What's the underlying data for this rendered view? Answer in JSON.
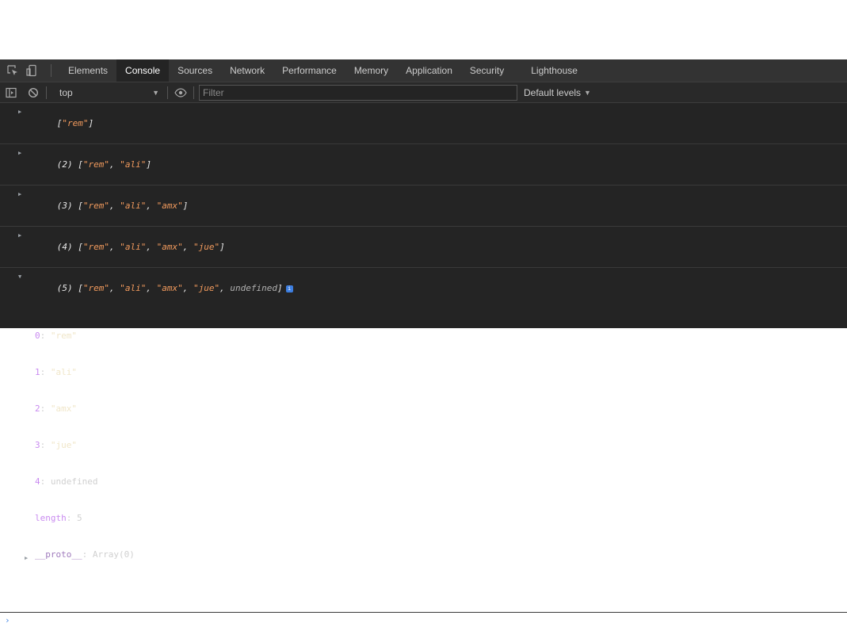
{
  "tabs": [
    {
      "label": "Elements"
    },
    {
      "label": "Console"
    },
    {
      "label": "Sources"
    },
    {
      "label": "Network"
    },
    {
      "label": "Performance"
    },
    {
      "label": "Memory"
    },
    {
      "label": "Application"
    },
    {
      "label": "Security"
    },
    {
      "label": "Lighthouse"
    }
  ],
  "active_tab": "Console",
  "toolbar": {
    "context": "top",
    "filter_placeholder": "Filter",
    "levels": "Default levels"
  },
  "messages": [
    {
      "count": "",
      "items": [
        "\"rem\""
      ]
    },
    {
      "count": "(2)",
      "items": [
        "\"rem\"",
        "\"ali\""
      ]
    },
    {
      "count": "(3)",
      "items": [
        "\"rem\"",
        "\"ali\"",
        "\"amx\""
      ]
    },
    {
      "count": "(4)",
      "items": [
        "\"rem\"",
        "\"ali\"",
        "\"amx\"",
        "\"jue\""
      ]
    }
  ],
  "expanded": {
    "count": "(5)",
    "items": [
      "\"rem\"",
      "\"ali\"",
      "\"amx\"",
      "\"jue\""
    ],
    "last_item": "undefined",
    "badge": "i",
    "properties": [
      {
        "key": "0",
        "value": "\"rem\""
      },
      {
        "key": "1",
        "value": "\"ali\""
      },
      {
        "key": "2",
        "value": "\"amx\""
      },
      {
        "key": "3",
        "value": "\"jue\""
      },
      {
        "key": "4",
        "value": "undefined"
      },
      {
        "key": "length",
        "value": "5"
      }
    ],
    "proto_key": "__proto__",
    "proto_value": "Array(0)"
  },
  "colors": {
    "string": "#f19a5d",
    "key": "#c98bf0",
    "prompt": "#4a8be8"
  }
}
